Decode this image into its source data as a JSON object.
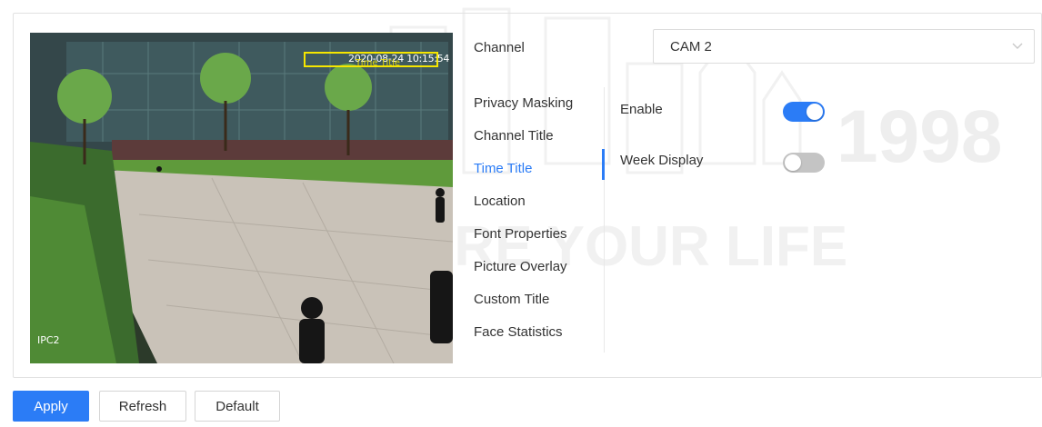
{
  "watermark": {
    "text_line1": "1998",
    "text_line2": "WE SECURE YOUR LIFE"
  },
  "preview": {
    "timestamp": "2020-08-24 10:15:54",
    "time_title_overlay": "Time Title",
    "channel_overlay": "IPC2"
  },
  "channel": {
    "label": "Channel",
    "value": "CAM 2",
    "icon": "chevron-down-icon"
  },
  "menu": {
    "items": [
      {
        "label": "Privacy Masking"
      },
      {
        "label": "Channel Title"
      },
      {
        "label": "Time Title"
      },
      {
        "label": "Location"
      },
      {
        "label": "Font Properties"
      },
      {
        "label": "Picture Overlay"
      },
      {
        "label": "Custom Title"
      },
      {
        "label": "Face Statistics"
      }
    ],
    "active": "Time Title"
  },
  "settings": {
    "enable_label": "Enable",
    "enable_on": true,
    "week_display_label": "Week Display",
    "week_display_on": false
  },
  "buttons": {
    "apply": "Apply",
    "refresh": "Refresh",
    "default": "Default"
  },
  "colors": {
    "accent": "#2b7cf6",
    "toggle_off": "#c4c4c4",
    "overlay_box": "#f6e600"
  }
}
